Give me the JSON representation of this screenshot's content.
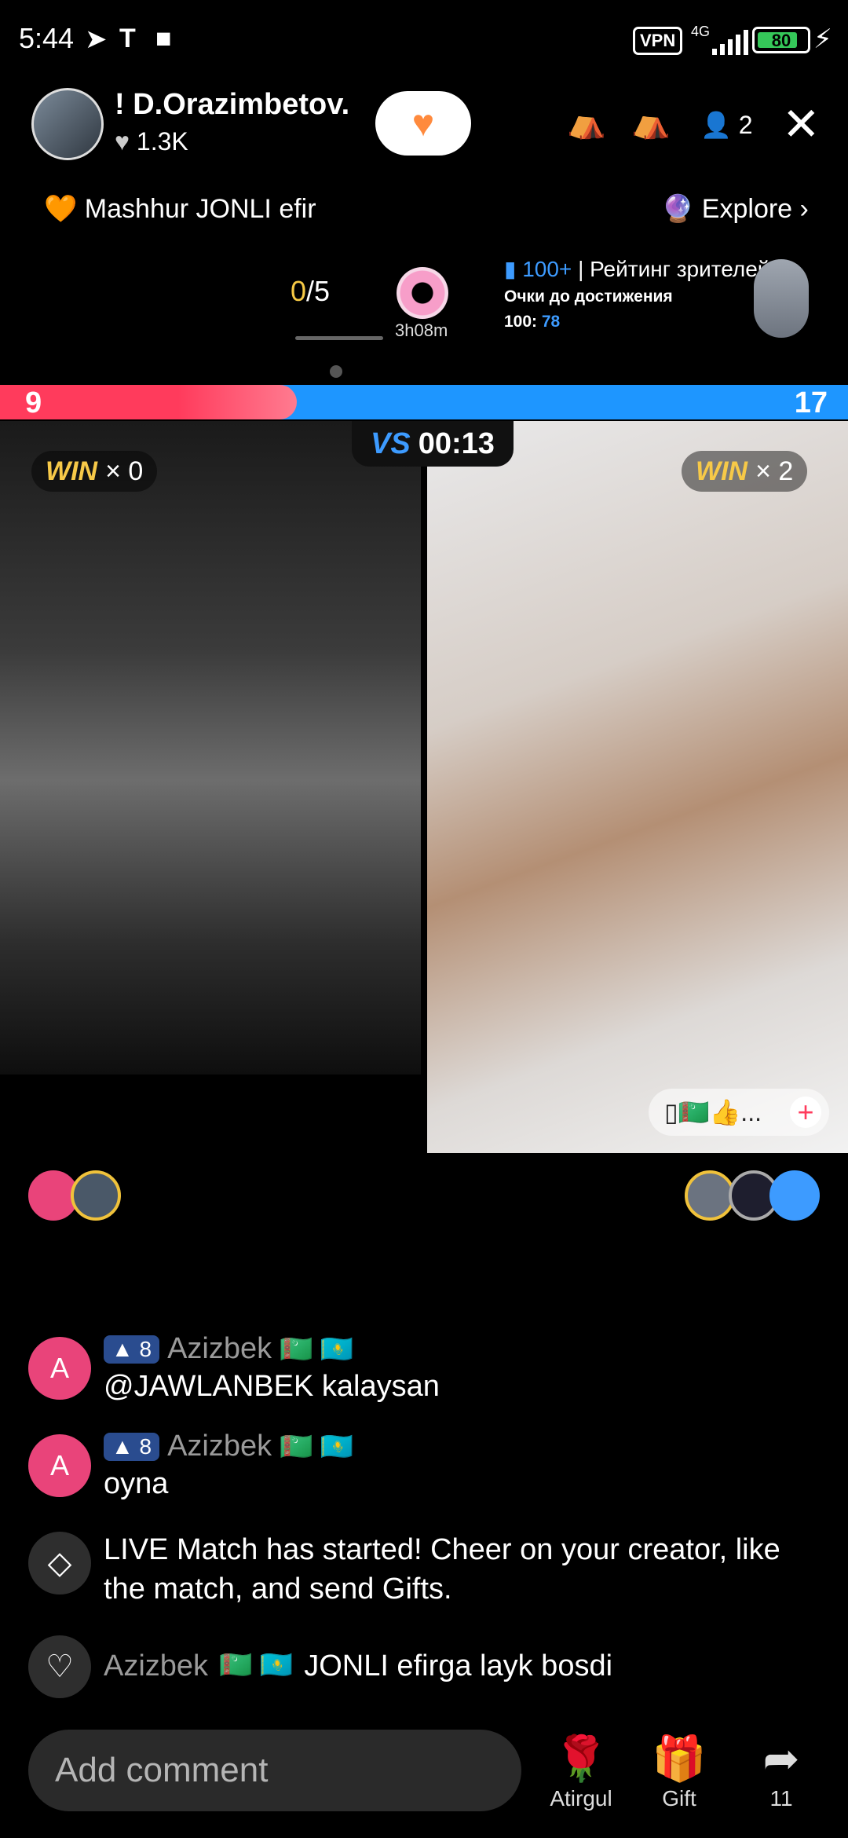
{
  "status": {
    "time": "5:44",
    "vpn": "VPN",
    "network": "4G",
    "battery": "80"
  },
  "header": {
    "host_name": "!  D.Orazimbetov.",
    "likes": "1.3K",
    "viewers": "2"
  },
  "topline": {
    "tag": "Mashhur JONLI efir",
    "explore": "Explore"
  },
  "goal": {
    "current": "0",
    "total": "/5",
    "timer": "3h08m"
  },
  "rating": {
    "rank": "100+",
    "label": "| Рейтинг зрителей",
    "sub": "Очки до достижения",
    "target": "100:",
    "points": "78"
  },
  "battle": {
    "score_left": "9",
    "score_right": "17",
    "vs": "VS",
    "timer": "00:13",
    "win_label": "WIN",
    "win_left": "× 0",
    "win_right": "× 2",
    "left_share": 0.35
  },
  "reactions": {
    "emojis": "▯🇹🇲👍...",
    "plus": "+"
  },
  "comments": [
    {
      "avatar": "A",
      "badge": "8",
      "name": "Azizbek",
      "flags": "🇹🇲 🇰🇿",
      "text": "@JAWLANBEK  kalaysan"
    },
    {
      "avatar": "A",
      "badge": "8",
      "name": "Azizbek",
      "flags": "🇹🇲 🇰🇿",
      "text": "oyna"
    }
  ],
  "system_message": "LIVE Match has started! Cheer on your creator, like the match, and send Gifts.",
  "like_message": {
    "name": "Azizbek",
    "flags": "🇹🇲 🇰🇿",
    "text": "JONLI efirga layk bosdi"
  },
  "bottom": {
    "placeholder": "Add comment",
    "rose_label": "Atirgul",
    "gift_label": "Gift",
    "share_count": "11"
  }
}
